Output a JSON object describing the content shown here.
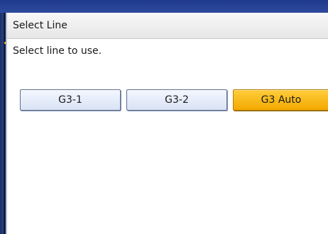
{
  "dialog": {
    "title": "Select Line",
    "prompt": "Select line to use."
  },
  "line_options": [
    {
      "label": "G3-1",
      "selected": false
    },
    {
      "label": "G3-2",
      "selected": false
    },
    {
      "label": "G3 Auto",
      "selected": true
    }
  ],
  "colors": {
    "frame": "#2a3f7a",
    "panel_background": "#ffffff",
    "button_normal": "#e3eaf7",
    "button_selected": "#f5b400"
  }
}
